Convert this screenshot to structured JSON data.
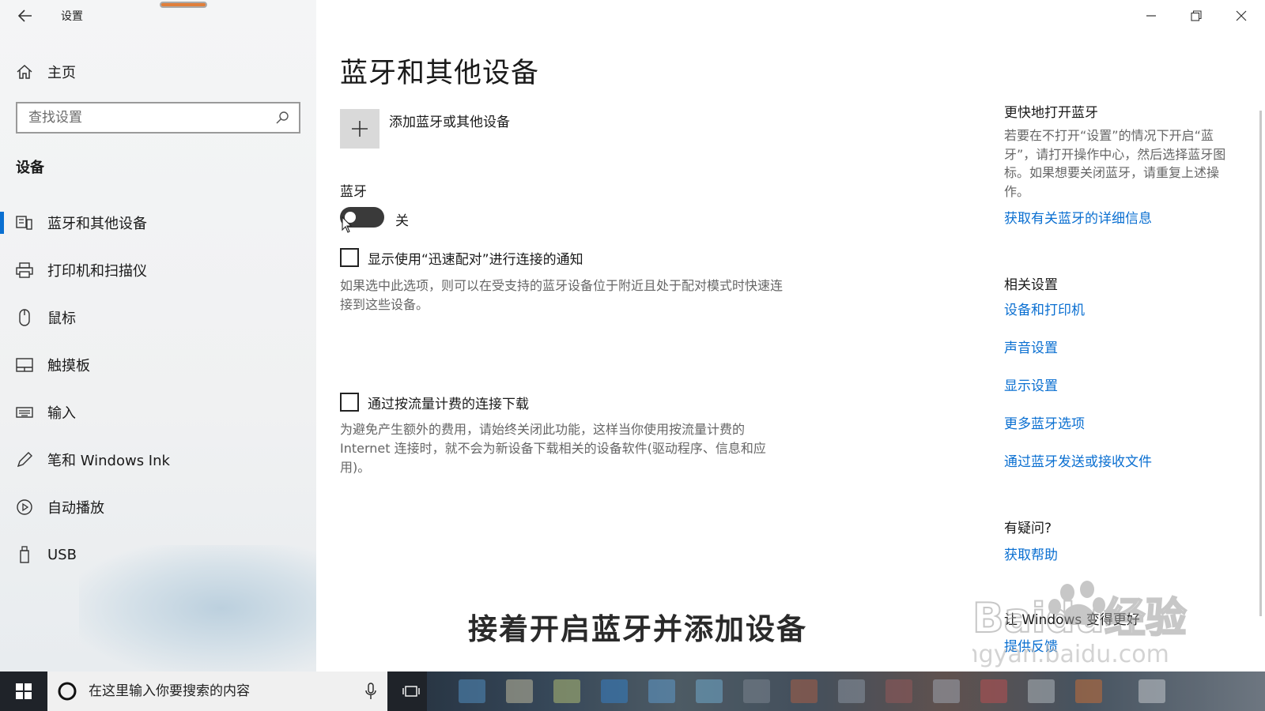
{
  "window": {
    "title": "设置"
  },
  "sidebar": {
    "home_label": "主页",
    "search_placeholder": "查找设置",
    "section_title": "设备",
    "items": [
      {
        "label": "蓝牙和其他设备",
        "icon": "bluetooth-devices-icon",
        "active": true
      },
      {
        "label": "打印机和扫描仪",
        "icon": "printer-icon",
        "active": false
      },
      {
        "label": "鼠标",
        "icon": "mouse-icon",
        "active": false
      },
      {
        "label": "触摸板",
        "icon": "touchpad-icon",
        "active": false
      },
      {
        "label": "输入",
        "icon": "keyboard-icon",
        "active": false
      },
      {
        "label": "笔和 Windows Ink",
        "icon": "pen-icon",
        "active": false
      },
      {
        "label": "自动播放",
        "icon": "autoplay-icon",
        "active": false
      },
      {
        "label": "USB",
        "icon": "usb-icon",
        "active": false
      }
    ]
  },
  "main": {
    "title": "蓝牙和其他设备",
    "add_device_label": "添加蓝牙或其他设备",
    "bluetooth_label": "蓝牙",
    "bluetooth_state": "关",
    "bluetooth_on": false,
    "swift_pair": {
      "label": "显示使用“迅速配对”进行连接的通知",
      "checked": false,
      "description": "如果选中此选项，则可以在受支持的蓝牙设备位于附近且处于配对模式时快速连接到这些设备。"
    },
    "metered": {
      "label": "通过按流量计费的连接下载",
      "checked": false,
      "description": "为避免产生额外的费用，请始终关闭此功能，这样当你使用按流量计费的 Internet 连接时，就不会为新设备下载相关的设备软件(驱动程序、信息和应用)。"
    }
  },
  "right": {
    "quick_title": "更快地打开蓝牙",
    "quick_text": "若要在不打开“设置”的情况下开启“蓝牙”，请打开操作中心，然后选择蓝牙图标。如果想要关闭蓝牙，请重复上述操作。",
    "quick_link": "获取有关蓝牙的详细信息",
    "related_title": "相关设置",
    "related_links": [
      "设备和打印机",
      "声音设置",
      "显示设置",
      "更多蓝牙选项",
      "通过蓝牙发送或接收文件"
    ],
    "help_title": "有疑问?",
    "help_link": "获取帮助",
    "feedback_title": "让 Windows 变得更好",
    "feedback_link": "提供反馈"
  },
  "overlay": {
    "caption": "接着开启蓝牙并添加设备",
    "watermark_brand": "Baidu经验",
    "watermark_url": "jingyan.baidu.com"
  },
  "taskbar": {
    "search_placeholder": "在这里输入你要搜索的内容"
  },
  "colors": {
    "accent": "#0a6fd1",
    "toggle_off": "#3a3a3a",
    "taskbar": "#1f2329"
  }
}
